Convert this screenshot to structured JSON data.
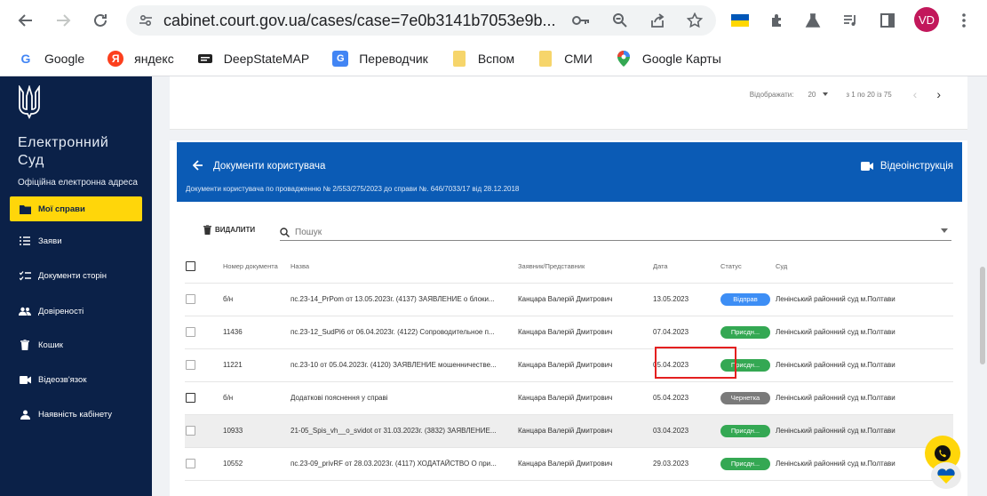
{
  "browser": {
    "url": "cabinet.court.gov.ua/cases/case=7e0b3141b7053e9b...",
    "profile_initials": "VD",
    "bookmarks": [
      {
        "label": "Google",
        "icon": "google-icon"
      },
      {
        "label": "яндекс",
        "icon": "yandex-icon"
      },
      {
        "label": "DeepStateMAP",
        "icon": "deepstate-icon"
      },
      {
        "label": "Переводчик",
        "icon": "translate-icon"
      },
      {
        "label": "Вспом",
        "icon": "folder-icon"
      },
      {
        "label": "СМИ",
        "icon": "folder-icon"
      },
      {
        "label": "Google Карты",
        "icon": "maps-pin-icon"
      }
    ]
  },
  "sidebar": {
    "title_line1": "Електронний",
    "title_line2": "Суд",
    "subtitle": "Офіційна електронна адреса",
    "items": [
      {
        "label": "Мої справи",
        "icon": "folder-icon",
        "active": true
      },
      {
        "label": "Заяви",
        "icon": "list-icon"
      },
      {
        "label": "Документи сторін",
        "icon": "checklist-icon"
      },
      {
        "label": "Довіреності",
        "icon": "people-icon"
      },
      {
        "label": "Кошик",
        "icon": "trash-icon"
      },
      {
        "label": "Відеозв'язок",
        "icon": "video-icon"
      },
      {
        "label": "Наявність кабінету",
        "icon": "person-icon"
      }
    ]
  },
  "pager": {
    "label": "Відображати:",
    "per_page": "20",
    "range": "з 1 по 20 із 75"
  },
  "panel": {
    "title": "Документи користувача",
    "subtitle": "Документи користувача по провадженню № 2/553/275/2023 до справи №. 646/7033/17 від 28.12.2018",
    "video_label": "Відеоінструкція",
    "delete_label": "ВИДАЛИТИ",
    "search_placeholder": "Пошук"
  },
  "table": {
    "headers": [
      "Номер документа",
      "Назва",
      "Заявник/Представник",
      "Дата",
      "Статус",
      "Суд"
    ],
    "rows": [
      {
        "num": "б/н",
        "name": "пс.23-14_PrPom от 13.05.2023г. (4137) ЗАЯВЛЕНИЕ о блоки...",
        "applicant": "Канцара Валерій Дмитрович",
        "date": "13.05.2023",
        "status": "Відправ",
        "court": "Ленінський районний суд м.Полтави",
        "cb": "light"
      },
      {
        "num": "11436",
        "name": "пс.23-12_SudPi6 от 06.04.2023г. (4122) Сопроводительное п...",
        "applicant": "Канцара Валерій Дмитрович",
        "date": "07.04.2023",
        "status": "Присдн...",
        "court": "Ленінський районний суд м.Полтави",
        "cb": "light"
      },
      {
        "num": "11221",
        "name": "пс.23-10 от 05.04.2023г. (4120) ЗАЯВЛЕНИЕ мошенничестве...",
        "applicant": "Канцара Валерій Дмитрович",
        "date": "05.04.2023",
        "status": "Присдн...",
        "court": "Ленінський районний суд м.Полтави",
        "cb": "light"
      },
      {
        "num": "б/н",
        "name": "Додаткові пояснення у справі",
        "applicant": "Канцара Валерій Дмитрович",
        "date": "05.04.2023",
        "status": "Чернетка",
        "court": "Ленінський районний суд м.Полтави",
        "cb": "dark"
      },
      {
        "num": "10933",
        "name": "21-05_Spis_vh__o_svidot от 31.03.2023г. (3832) ЗАЯВЛЕНИЕ...",
        "applicant": "Канцара Валерій Дмитрович",
        "date": "03.04.2023",
        "status": "Присдн...",
        "court": "Ленінський районний суд м.Полтави",
        "cb": "light"
      },
      {
        "num": "10552",
        "name": "пс.23-09_privRF от 28.03.2023г. (4117) ХОДАТАЙСТВО О при...",
        "applicant": "Канцара Валерій Дмитрович",
        "date": "29.03.2023",
        "status": "Присдн...",
        "court": "Ленінський районний суд м.Полтави",
        "cb": "light"
      }
    ]
  },
  "colors": {
    "sidebar_bg": "#0b2148",
    "accent_yellow": "#ffd60a",
    "banner_blue": "#0b5bb5",
    "status_sent": "#3d8ef5",
    "status_accepted": "#34a853",
    "status_draft": "#7a7a7a",
    "highlight_red": "#e41f1f"
  }
}
